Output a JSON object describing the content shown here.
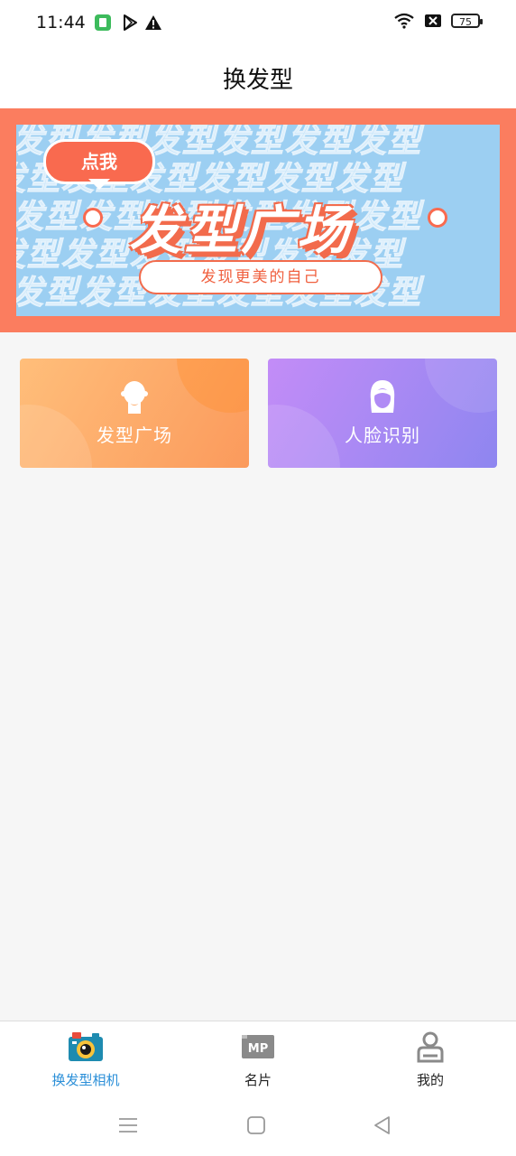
{
  "status": {
    "time": "11:44",
    "battery": "75"
  },
  "header": {
    "title": "换发型"
  },
  "banner": {
    "pattern_text": "发型发型发型发型发型发型",
    "bubble_label": "点我",
    "headline": "发型广场",
    "tagline": "发现更美的自己"
  },
  "cards": [
    {
      "label": "发型广场",
      "icon": "head-silhouette-icon"
    },
    {
      "label": "人脸识别",
      "icon": "female-face-icon"
    }
  ],
  "bottom_nav": {
    "items": [
      {
        "label": "换发型相机",
        "icon": "camera-icon",
        "active": true
      },
      {
        "label": "名片",
        "icon": "mp-card-icon",
        "active": false
      },
      {
        "label": "我的",
        "icon": "profile-icon",
        "active": false
      }
    ],
    "active_color": "#2b8fd8"
  },
  "colors": {
    "banner_orange": "#fb7d5f",
    "banner_blue": "#9ccff2",
    "card_left": "#fb9a5c",
    "card_right": "#a78af4"
  }
}
